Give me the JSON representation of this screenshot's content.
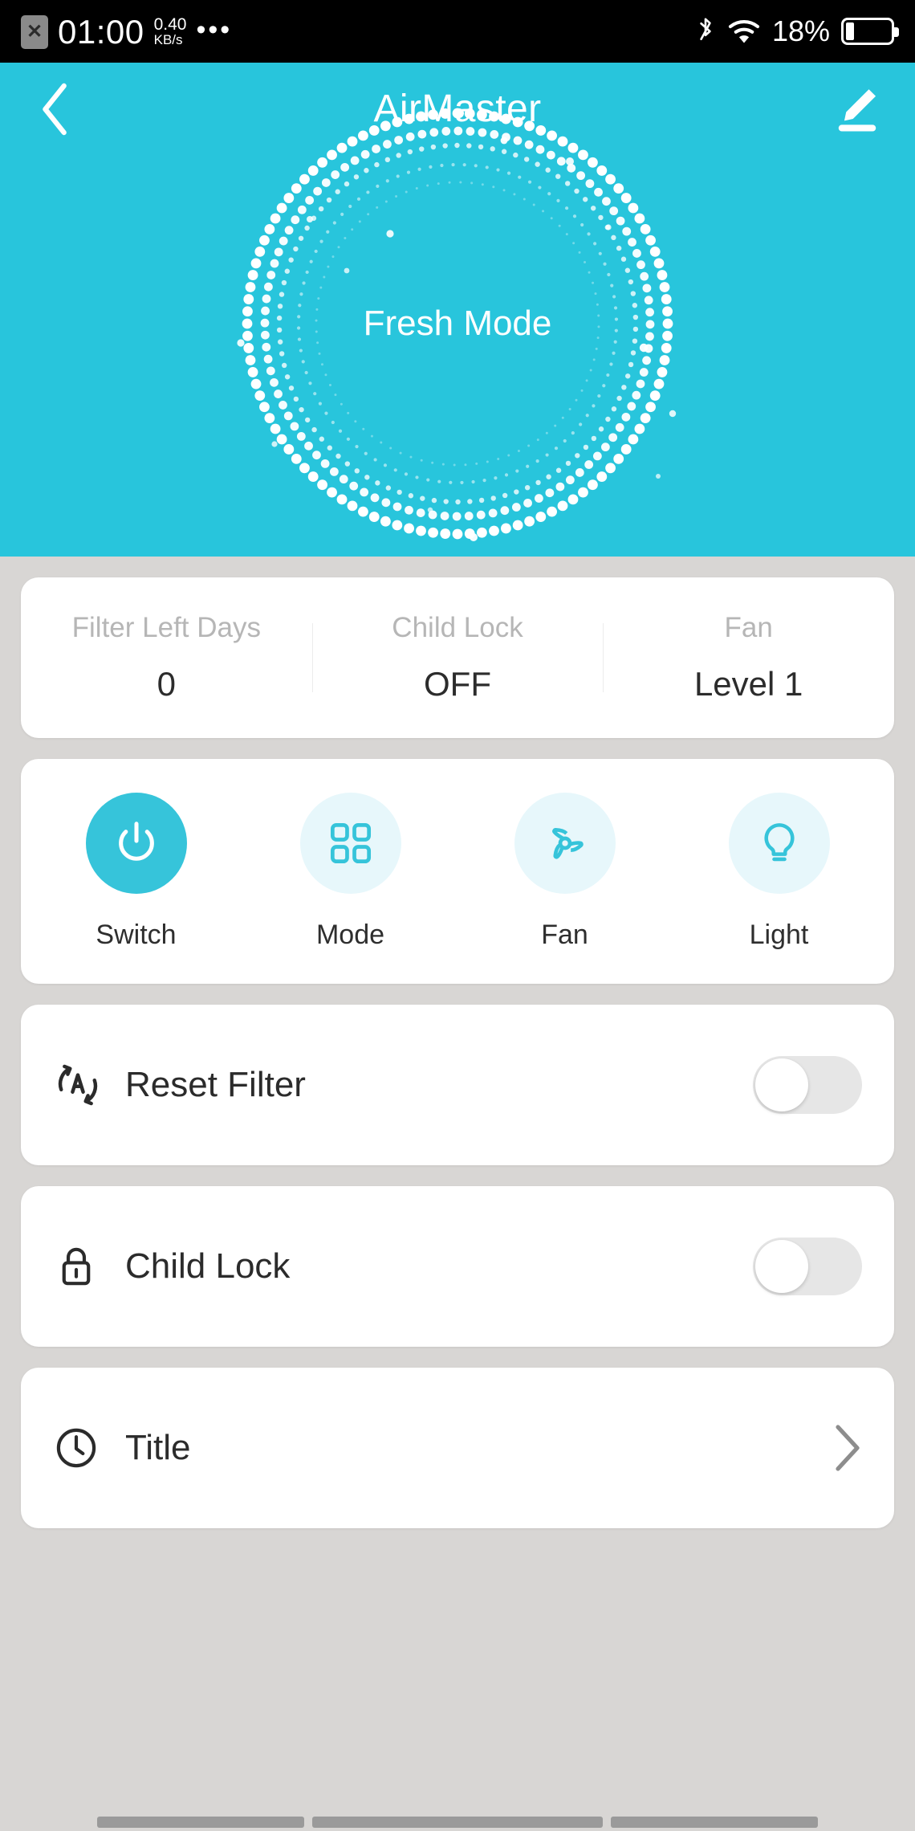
{
  "statusbar": {
    "sim_icon": "sim-disabled-icon",
    "time": "01:00",
    "net_speed_value": "0.40",
    "net_speed_unit": "KB/s",
    "overflow": "•••",
    "bluetooth_icon": "bluetooth-icon",
    "wifi_icon": "wifi-icon",
    "battery_percent": "18%",
    "battery_icon": "battery-icon"
  },
  "header": {
    "back_icon": "back-chevron-icon",
    "title": "AirMaster",
    "edit_icon": "edit-pencil-icon",
    "accent_color": "#28c5dc"
  },
  "hero": {
    "mode_label": "Fresh Mode",
    "background_color": "#28c5dc",
    "ring_color": "#ffffff"
  },
  "stats": [
    {
      "label": "Filter Left Days",
      "value": "0"
    },
    {
      "label": "Child Lock",
      "value": "OFF"
    },
    {
      "label": "Fan",
      "value": "Level 1"
    }
  ],
  "actions": [
    {
      "label": "Switch",
      "icon": "power-icon",
      "active": true
    },
    {
      "label": "Mode",
      "icon": "grid-icon",
      "active": false
    },
    {
      "label": "Fan",
      "icon": "fan-icon",
      "active": false
    },
    {
      "label": "Light",
      "icon": "lightbulb-icon",
      "active": false
    }
  ],
  "rows": [
    {
      "label": "Reset Filter",
      "icon": "auto-reset-icon",
      "control": "toggle",
      "state": "off"
    },
    {
      "label": "Child Lock",
      "icon": "lock-icon",
      "control": "toggle",
      "state": "off"
    },
    {
      "label": "Title",
      "icon": "clock-icon",
      "control": "chevron",
      "state": ""
    }
  ],
  "colors": {
    "accent": "#36c4da",
    "accent_soft": "#e7f7fb",
    "page_bg": "#d8d6d4",
    "card_bg": "#ffffff",
    "toggle_off": "#e6e6e6"
  }
}
